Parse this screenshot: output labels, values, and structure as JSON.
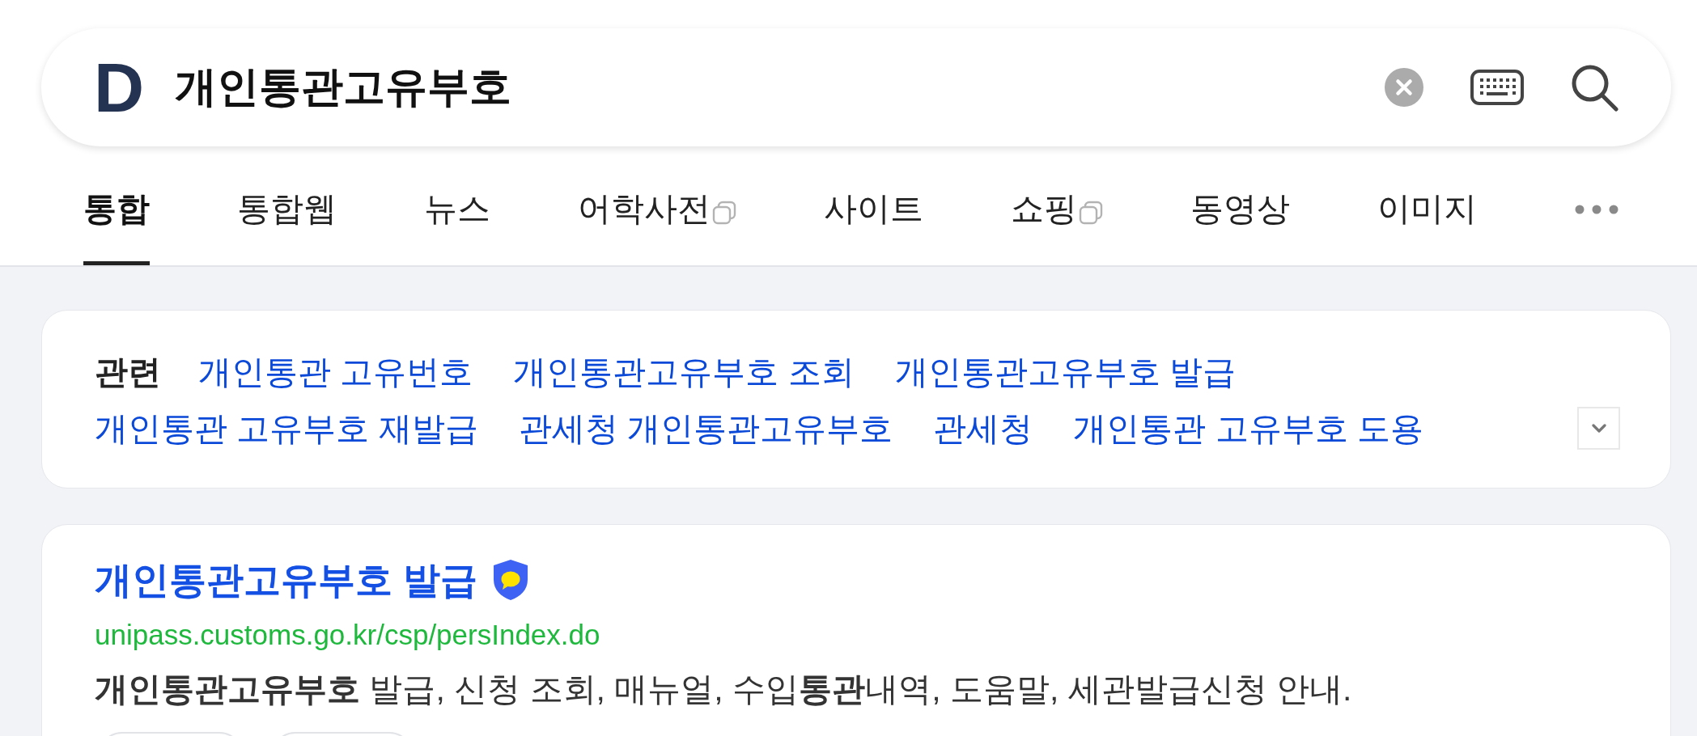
{
  "search": {
    "logo": "D",
    "query": "개인통관고유부호"
  },
  "tabs": [
    {
      "label": "통합",
      "selected": true,
      "new_window": false
    },
    {
      "label": "통합웹",
      "selected": false,
      "new_window": false
    },
    {
      "label": "뉴스",
      "selected": false,
      "new_window": false
    },
    {
      "label": "어학사전",
      "selected": false,
      "new_window": true
    },
    {
      "label": "사이트",
      "selected": false,
      "new_window": false
    },
    {
      "label": "쇼핑",
      "selected": false,
      "new_window": true
    },
    {
      "label": "동영상",
      "selected": false,
      "new_window": false
    },
    {
      "label": "이미지",
      "selected": false,
      "new_window": false
    }
  ],
  "related": {
    "label": "관련",
    "links": [
      "개인통관 고유번호",
      "개인통관고유부호 조회",
      "개인통관고유부호 발급",
      "개인통관 고유부호 재발급",
      "관세청 개인통관고유부호",
      "관세청",
      "개인통관 고유부호 도용"
    ],
    "expanded": false
  },
  "results": [
    {
      "title": "개인통관고유부호 발급",
      "verified": true,
      "url": "unipass.customs.go.kr/csp/persIndex.do",
      "description": "**개인통관고유부호** 발급, 신청 조회, 매뉴얼, 수입**통관**내역, 도움말, 세관발급신청 안내."
    }
  ]
}
